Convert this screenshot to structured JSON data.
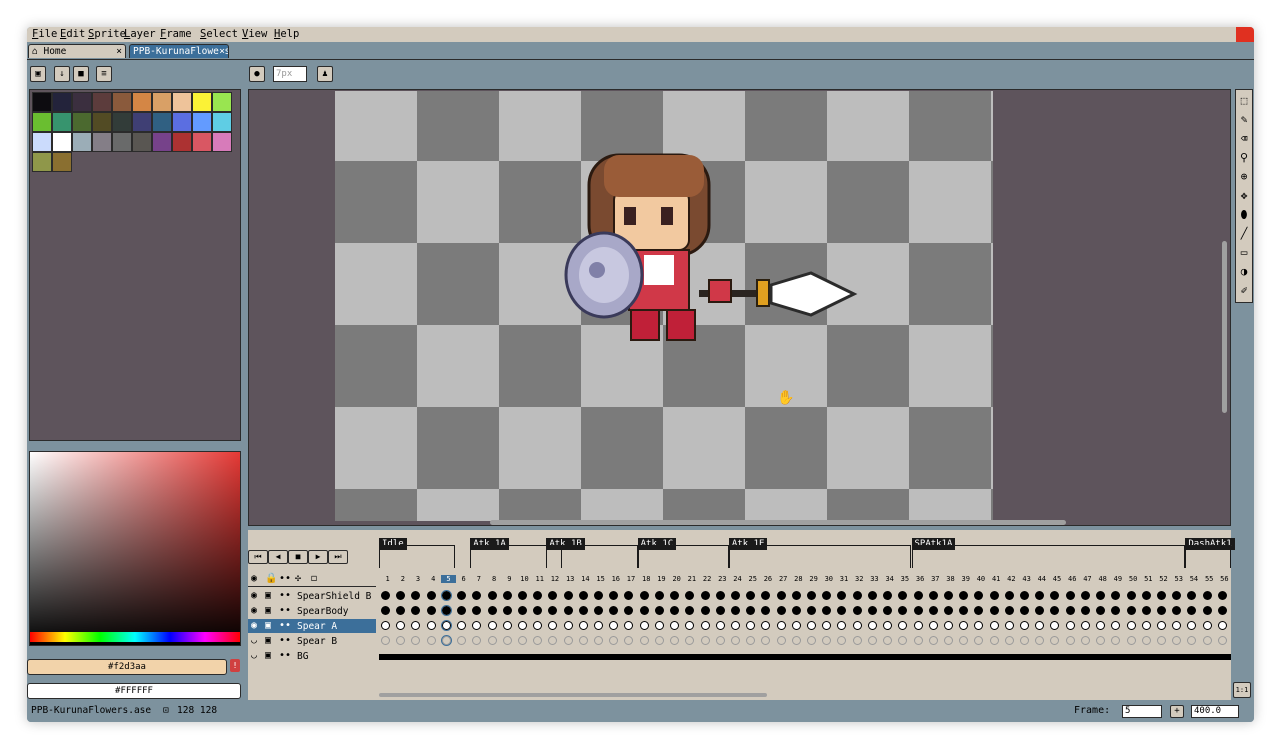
{
  "menu": [
    "File",
    "Edit",
    "Sprite",
    "Layer",
    "Frame",
    "Select",
    "View",
    "Help"
  ],
  "tabs": [
    {
      "label": "Home",
      "close": "×"
    },
    {
      "label": "PPB-KurunaFlowers.ase",
      "close": "×"
    }
  ],
  "palette_tools": [
    "lock-icon",
    "down-arrow-icon",
    "square-icon",
    "list-icon"
  ],
  "brush": {
    "size": "7px"
  },
  "palette_colors": [
    "#0d0c10",
    "#23233b",
    "#3b2f3f",
    "#5c3c3c",
    "#8a5a3c",
    "#d48645",
    "#d9a066",
    "#eec39a",
    "#fbf236",
    "#99e550",
    "#6abe30",
    "#37946e",
    "#4b692f",
    "#524b24",
    "#323c39",
    "#3f3f74",
    "#306082",
    "#5b6ee1",
    "#639bff",
    "#5fcde4",
    "#cbdbfc",
    "#ffffff",
    "#9badb7",
    "#847e87",
    "#696a6a",
    "#595652",
    "#76428a",
    "#ac3232",
    "#d95763",
    "#d77bba",
    "#8f974a",
    "#8a6f30"
  ],
  "primary_color": "#f2d3aa",
  "secondary_color": "#ffffff",
  "primary_hex_label": "#f2d3aa",
  "secondary_hex_label": "#FFFFFF",
  "tools": [
    "rect-select-icon",
    "pencil-icon",
    "eraser-icon",
    "eyedropper-icon",
    "zoom-icon",
    "move-icon",
    "fill-icon",
    "line-icon",
    "rectangle-icon",
    "blur-icon",
    "brush-icon"
  ],
  "timeline": {
    "controls": [
      "first-frame-icon",
      "prev-frame-icon",
      "stop-icon",
      "next-frame-icon",
      "last-frame-icon"
    ],
    "tags": [
      {
        "name": "Idle",
        "start": 1,
        "end": 5
      },
      {
        "name": "Atk 1A",
        "start": 7,
        "end": 12
      },
      {
        "name": "Atk 1B",
        "start": 12,
        "end": 17
      },
      {
        "name": "Atk 1C",
        "start": 18,
        "end": 23
      },
      {
        "name": "Atk 1E",
        "start": 24,
        "end": 35
      },
      {
        "name": "SPAtk1A",
        "start": 36,
        "end": 53
      },
      {
        "name": "DashAtk1",
        "start": 54,
        "end": 56
      }
    ],
    "frame_count": 56,
    "current_frame": 5,
    "layers": [
      {
        "name": "SpearShield B",
        "visible": true,
        "cel": "filled"
      },
      {
        "name": "SpearBody",
        "visible": true,
        "cel": "filled"
      },
      {
        "name": "Spear A",
        "visible": true,
        "cel": "hollow",
        "selected": true
      },
      {
        "name": "Spear B",
        "visible": false,
        "cel": "empty"
      },
      {
        "name": "BG",
        "visible": false,
        "cel": "bar"
      }
    ]
  },
  "status": {
    "file": "PPB-KurunaFlowers.ase",
    "size": "128 128",
    "frame_label": "Frame:",
    "frame_value": "5",
    "zoom": "400.0"
  }
}
